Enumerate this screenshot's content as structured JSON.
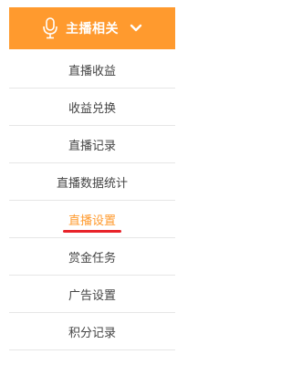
{
  "theme": {
    "accent": "#ff9a2e",
    "highlight": "#e8232a"
  },
  "header": {
    "title": "主播相关",
    "icon": "microphone-icon",
    "toggle_icon": "chevron-down-icon"
  },
  "menu": {
    "active_index": 4,
    "items": [
      {
        "label": "直播收益"
      },
      {
        "label": "收益兑换"
      },
      {
        "label": "直播记录"
      },
      {
        "label": "直播数据统计"
      },
      {
        "label": "直播设置"
      },
      {
        "label": "赏金任务"
      },
      {
        "label": "广告设置"
      },
      {
        "label": "积分记录"
      }
    ]
  }
}
